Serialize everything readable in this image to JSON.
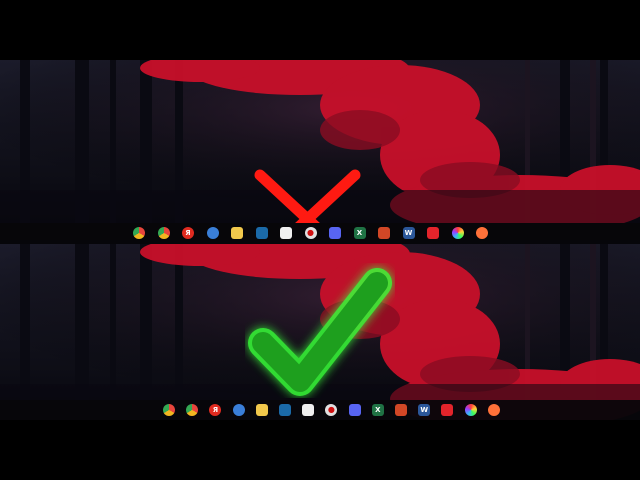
{
  "verdict": {
    "wrong": "red-x",
    "right": "green-checkmark"
  },
  "colors": {
    "letterbox": "#000000",
    "foliage": "#d0122a",
    "cross": "#ff1a12",
    "check_fill": "#1e9f1e",
    "check_glow": "#39ff39",
    "taskbar": "#08060a"
  },
  "taskbar_wrong": {
    "alignment": "off-center",
    "icons": [
      {
        "name": "chrome-icon",
        "color": "#e8453c",
        "glyph": ""
      },
      {
        "name": "chrome-canary-icon",
        "color": "#f2b620",
        "glyph": ""
      },
      {
        "name": "yandex-icon",
        "color": "#e02b20",
        "glyph": "Я"
      },
      {
        "name": "globe-browser-icon",
        "color": "#3a7fd8",
        "glyph": ""
      },
      {
        "name": "file-explorer-icon",
        "color": "#f2c94c",
        "glyph": ""
      },
      {
        "name": "steam-icon",
        "color": "#1b6aa8",
        "glyph": ""
      },
      {
        "name": "microsoft-store-icon",
        "color": "#e9e9e9",
        "glyph": ""
      },
      {
        "name": "obs-record-icon",
        "color": "#e0e0e0",
        "glyph": "●"
      },
      {
        "name": "discord-icon",
        "color": "#5865f2",
        "glyph": ""
      },
      {
        "name": "excel-icon",
        "color": "#1f7244",
        "glyph": "X"
      },
      {
        "name": "powerpoint-icon",
        "color": "#d24726",
        "glyph": ""
      },
      {
        "name": "word-icon",
        "color": "#2b579a",
        "glyph": "W"
      },
      {
        "name": "acrobat-icon",
        "color": "#e3242b",
        "glyph": ""
      },
      {
        "name": "color-wheel-icon",
        "color": "#8a4fd8",
        "glyph": ""
      },
      {
        "name": "firefox-icon",
        "color": "#ff7139",
        "glyph": ""
      }
    ]
  },
  "taskbar_right": {
    "alignment": "centered",
    "icons": [
      {
        "name": "chrome-icon",
        "color": "#e8453c",
        "glyph": ""
      },
      {
        "name": "chrome-canary-icon",
        "color": "#f2b620",
        "glyph": ""
      },
      {
        "name": "yandex-icon",
        "color": "#e02b20",
        "glyph": "Я"
      },
      {
        "name": "globe-browser-icon",
        "color": "#3a7fd8",
        "glyph": ""
      },
      {
        "name": "file-explorer-icon",
        "color": "#f2c94c",
        "glyph": ""
      },
      {
        "name": "steam-icon",
        "color": "#1b6aa8",
        "glyph": ""
      },
      {
        "name": "microsoft-store-icon",
        "color": "#e9e9e9",
        "glyph": ""
      },
      {
        "name": "obs-record-icon",
        "color": "#e0e0e0",
        "glyph": "●"
      },
      {
        "name": "discord-icon",
        "color": "#5865f2",
        "glyph": ""
      },
      {
        "name": "excel-icon",
        "color": "#1f7244",
        "glyph": "X"
      },
      {
        "name": "powerpoint-icon",
        "color": "#d24726",
        "glyph": ""
      },
      {
        "name": "word-icon",
        "color": "#2b579a",
        "glyph": "W"
      },
      {
        "name": "acrobat-icon",
        "color": "#e3242b",
        "glyph": ""
      },
      {
        "name": "color-wheel-icon",
        "color": "#8a4fd8",
        "glyph": ""
      },
      {
        "name": "firefox-icon",
        "color": "#ff7139",
        "glyph": ""
      }
    ]
  }
}
